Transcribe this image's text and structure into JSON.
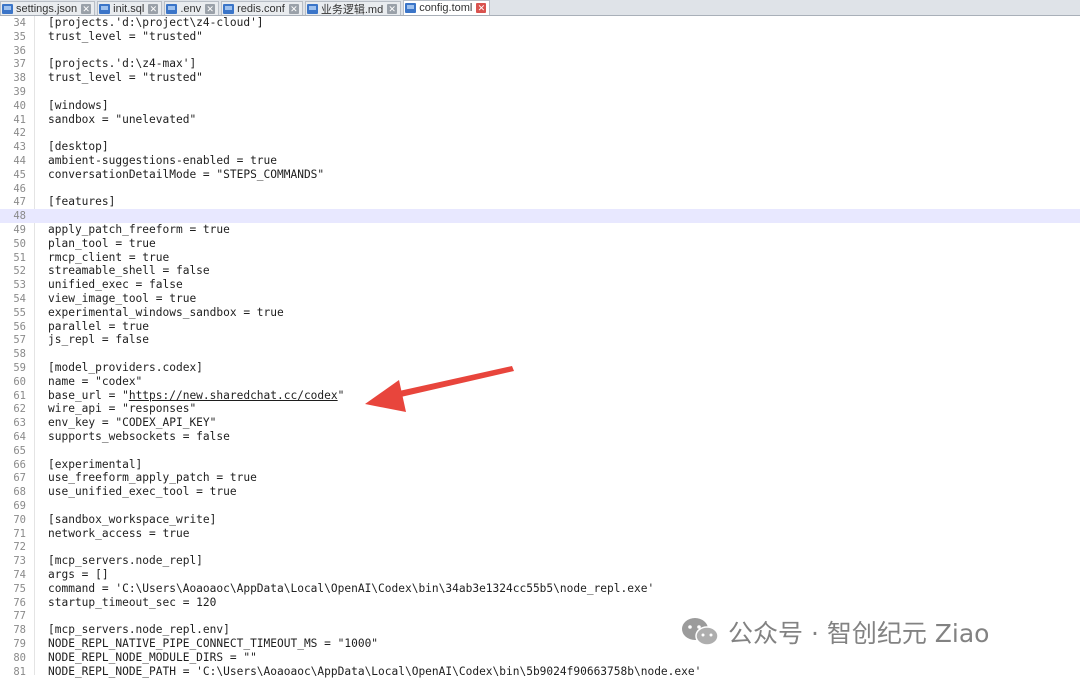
{
  "tabs": [
    {
      "label": "settings.json",
      "active": false
    },
    {
      "label": "init.sql",
      "active": false
    },
    {
      "label": ".env",
      "active": false
    },
    {
      "label": "redis.conf",
      "active": false
    },
    {
      "label": "业务逻辑.md",
      "active": false
    },
    {
      "label": "config.toml",
      "active": true
    }
  ],
  "editor": {
    "current_line": 48,
    "lines": [
      {
        "n": "34",
        "text": "[projects.'d:\\project\\z4-cloud']"
      },
      {
        "n": "35",
        "text": "trust_level = \"trusted\""
      },
      {
        "n": "36",
        "text": ""
      },
      {
        "n": "37",
        "text": "[projects.'d:\\z4-max']"
      },
      {
        "n": "38",
        "text": "trust_level = \"trusted\""
      },
      {
        "n": "39",
        "text": ""
      },
      {
        "n": "40",
        "text": "[windows]"
      },
      {
        "n": "41",
        "text": "sandbox = \"unelevated\""
      },
      {
        "n": "42",
        "text": ""
      },
      {
        "n": "43",
        "text": "[desktop]"
      },
      {
        "n": "44",
        "text": "ambient-suggestions-enabled = true"
      },
      {
        "n": "45",
        "text": "conversationDetailMode = \"STEPS_COMMANDS\""
      },
      {
        "n": "46",
        "text": ""
      },
      {
        "n": "47",
        "text": "[features]"
      },
      {
        "n": "48",
        "text": ""
      },
      {
        "n": "49",
        "text": "apply_patch_freeform = true"
      },
      {
        "n": "50",
        "text": "plan_tool = true"
      },
      {
        "n": "51",
        "text": "rmcp_client = true"
      },
      {
        "n": "52",
        "text": "streamable_shell = false"
      },
      {
        "n": "53",
        "text": "unified_exec = false"
      },
      {
        "n": "54",
        "text": "view_image_tool = true"
      },
      {
        "n": "55",
        "text": "experimental_windows_sandbox = true"
      },
      {
        "n": "56",
        "text": "parallel = true"
      },
      {
        "n": "57",
        "text": "js_repl = false"
      },
      {
        "n": "58",
        "text": ""
      },
      {
        "n": "59",
        "text": "[model_providers.codex]"
      },
      {
        "n": "60",
        "text": "name = \"codex\""
      },
      {
        "n": "61",
        "text": "base_url = \"https://new.sharedchat.cc/codex\"",
        "pre": "base_url = \"",
        "url": "https://new.sharedchat.cc/codex",
        "post": "\""
      },
      {
        "n": "62",
        "text": "wire_api = \"responses\""
      },
      {
        "n": "63",
        "text": "env_key = \"CODEX_API_KEY\""
      },
      {
        "n": "64",
        "text": "supports_websockets = false"
      },
      {
        "n": "65",
        "text": ""
      },
      {
        "n": "66",
        "text": "[experimental]"
      },
      {
        "n": "67",
        "text": "use_freeform_apply_patch = true"
      },
      {
        "n": "68",
        "text": "use_unified_exec_tool = true"
      },
      {
        "n": "69",
        "text": ""
      },
      {
        "n": "70",
        "text": "[sandbox_workspace_write]"
      },
      {
        "n": "71",
        "text": "network_access = true"
      },
      {
        "n": "72",
        "text": ""
      },
      {
        "n": "73",
        "text": "[mcp_servers.node_repl]"
      },
      {
        "n": "74",
        "text": "args = []"
      },
      {
        "n": "75",
        "text": "command = 'C:\\Users\\Aoaoaoc\\AppData\\Local\\OpenAI\\Codex\\bin\\34ab3e1324cc55b5\\node_repl.exe'"
      },
      {
        "n": "76",
        "text": "startup_timeout_sec = 120"
      },
      {
        "n": "77",
        "text": ""
      },
      {
        "n": "78",
        "text": "[mcp_servers.node_repl.env]"
      },
      {
        "n": "79",
        "text": "NODE_REPL_NATIVE_PIPE_CONNECT_TIMEOUT_MS = \"1000\""
      },
      {
        "n": "80",
        "text": "NODE_REPL_NODE_MODULE_DIRS = \"\""
      },
      {
        "n": "81",
        "text": "NODE_REPL_NODE_PATH = 'C:\\Users\\Aoaoaoc\\AppData\\Local\\OpenAI\\Codex\\bin\\5b9024f90663758b\\node.exe'"
      }
    ]
  },
  "annotation": {
    "color": "#e8453c",
    "target": "base_url"
  },
  "watermark": {
    "text": "公众号 · 智创纪元 Ziao"
  }
}
